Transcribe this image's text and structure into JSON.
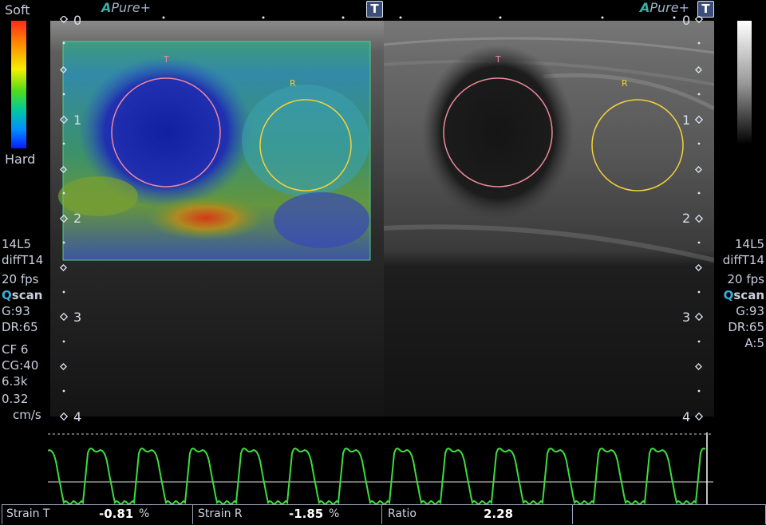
{
  "colorbar": {
    "top_label": "Soft",
    "bottom_label": "Hard"
  },
  "left_info": {
    "probe": "14L5",
    "mode": "diffT14",
    "fps": "20 fps",
    "qscan_q": "Q",
    "qscan_rest": "scan",
    "gain": "G:93",
    "dr": "DR:65",
    "cf": "CF 6",
    "cg": "CG:40",
    "freq": "6.3k",
    "velocity": "0.32",
    "velocity_unit": "cm/s"
  },
  "right_info": {
    "probe": "14L5",
    "mode": "diffT14",
    "fps": "20 fps",
    "qscan_q": "Q",
    "qscan_rest": "scan",
    "gain": "G:93",
    "dr": "DR:65",
    "avg": "A:5"
  },
  "left_panel": {
    "brand_a": "A",
    "brand_pure": "Pure",
    "brand_plus": "+",
    "badge": "T",
    "depth_labels": [
      "0",
      "1",
      "2",
      "3",
      "4"
    ],
    "roi_t": "T",
    "roi_r": "R"
  },
  "right_panel": {
    "brand_a": "A",
    "brand_pure": "Pure",
    "brand_plus": "+",
    "badge": "T",
    "depth_labels": [
      "0",
      "1",
      "2",
      "3",
      "4"
    ],
    "roi_t": "T",
    "roi_r": "R"
  },
  "colors": {
    "roi_t": "#f08a9a",
    "roi_r": "#f3d23a",
    "trace": "#3ddc3d",
    "elasto_box": "#4fd08c"
  },
  "status": {
    "strain_t_label": "Strain T",
    "strain_t_value": "-0.81",
    "strain_t_unit": "%",
    "strain_r_label": "Strain R",
    "strain_r_value": "-1.85",
    "strain_r_unit": "%",
    "ratio_label": "Ratio",
    "ratio_value": "2.28"
  }
}
